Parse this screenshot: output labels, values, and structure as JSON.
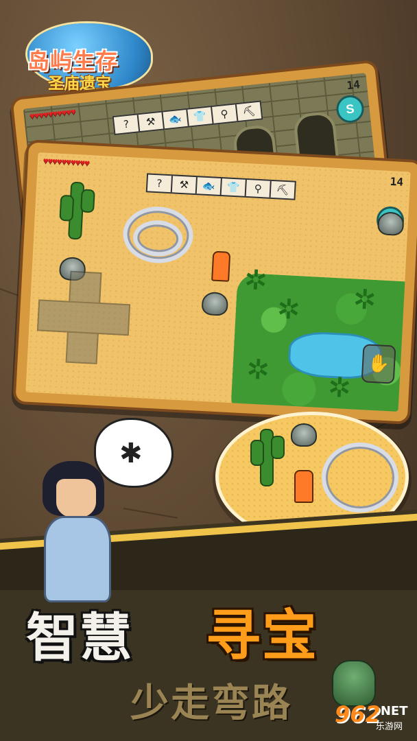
{
  "logo": {
    "line1": "岛屿生存",
    "line2": "圣庙遗宝"
  },
  "hud": {
    "hearts": "♥♥♥♥♥♥♥♥♥♥",
    "help_icon": "?",
    "inventory_icons": [
      "axe-icon",
      "fish-icon",
      "shirt-icon",
      "shovel-icon",
      "pickaxe-icon"
    ],
    "inventory_glyphs": [
      "⚒",
      "🐟",
      "👕",
      "⚲",
      "⛏"
    ],
    "day_counter_back": "14",
    "day_counter_front": "14",
    "compass_label": "S"
  },
  "controls": {
    "action_glyph": "✋"
  },
  "slogan": {
    "left": "智慧",
    "right": "寻宝",
    "sub": "少走弯路"
  },
  "watermark": {
    "number": "962",
    "domain": ".NET",
    "site_cn": "乐游网"
  },
  "colors": {
    "slogan_accent": "#ff9c1a",
    "sand": "#f0c36a",
    "grass": "#3f9a33",
    "water": "#4fc3e8"
  }
}
